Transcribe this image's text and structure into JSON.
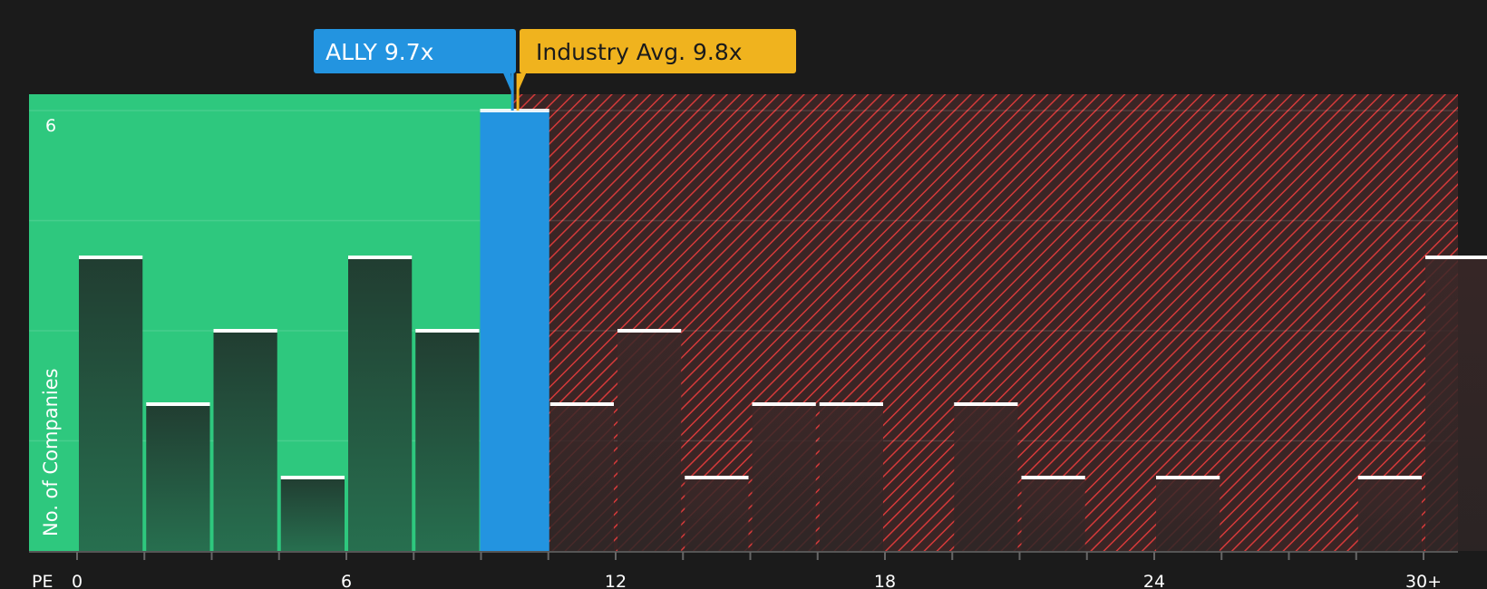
{
  "chart_data": {
    "type": "bar",
    "x_axis_title": "PE",
    "y_axis_title": "No. of Companies",
    "x_ticks": [
      "0",
      "6",
      "12",
      "18",
      "24",
      "30+"
    ],
    "y_ticks": [
      "6"
    ],
    "bin_width": 1.5,
    "x_range": [
      0,
      30
    ],
    "ylim": [
      0,
      6
    ],
    "grid": true,
    "bins": [
      {
        "start": 0.0,
        "count": 4
      },
      {
        "start": 1.5,
        "count": 2
      },
      {
        "start": 3.0,
        "count": 3
      },
      {
        "start": 4.5,
        "count": 1
      },
      {
        "start": 6.0,
        "count": 4
      },
      {
        "start": 7.5,
        "count": 3
      },
      {
        "start": 9.0,
        "count": 6
      },
      {
        "start": 10.5,
        "count": 2
      },
      {
        "start": 12.0,
        "count": 3
      },
      {
        "start": 13.5,
        "count": 1
      },
      {
        "start": 15.0,
        "count": 2
      },
      {
        "start": 16.5,
        "count": 2
      },
      {
        "start": 18.0,
        "count": 0
      },
      {
        "start": 19.5,
        "count": 2
      },
      {
        "start": 21.0,
        "count": 1
      },
      {
        "start": 22.5,
        "count": 0
      },
      {
        "start": 24.0,
        "count": 1
      },
      {
        "start": 25.5,
        "count": 0
      },
      {
        "start": 27.0,
        "count": 0
      },
      {
        "start": 28.5,
        "count": 1
      },
      {
        "start": 30.0,
        "count": 4
      }
    ],
    "highlight_bin_start": 9.0,
    "company": {
      "label": "ALLY 9.7x",
      "value": 9.7,
      "color": "#2394e0"
    },
    "industry": {
      "label": "Industry Avg. 9.8x",
      "value": 9.8,
      "color": "#f0b31e"
    },
    "colors": {
      "background": "#1b1b1b",
      "undervalued_zone": "#2ec87e",
      "overvalued_zone": "#3a2525",
      "hatch": "#d63a3a",
      "bar_dark": "#1f3a2e",
      "bar_highlight": "#2394e0",
      "cap": "#ffffff"
    }
  }
}
